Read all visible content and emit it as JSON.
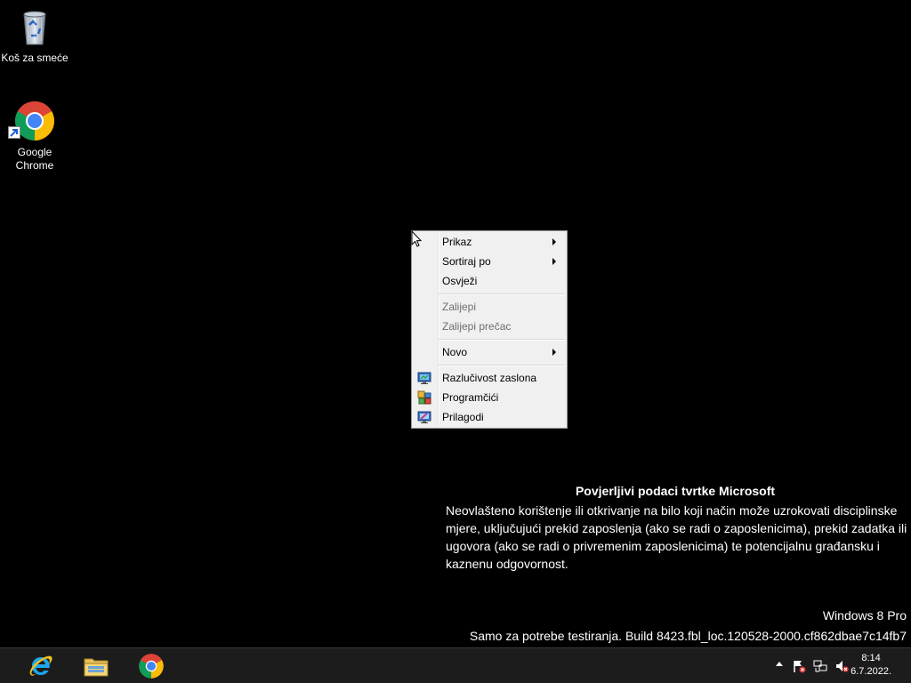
{
  "desktop": {
    "icons": [
      {
        "label": "Koš za smeće",
        "icon": "recycle-bin-icon"
      },
      {
        "label": "Google Chrome",
        "label_line1": "Google",
        "label_line2": "Chrome",
        "icon": "chrome-icon"
      }
    ]
  },
  "context_menu": {
    "items": [
      {
        "label": "Prikaz",
        "submenu": true,
        "enabled": true
      },
      {
        "label": "Sortiraj po",
        "submenu": true,
        "enabled": true
      },
      {
        "label": "Osvježi",
        "submenu": false,
        "enabled": true
      },
      {
        "label": "Zalijepi",
        "submenu": false,
        "enabled": false
      },
      {
        "label": "Zalijepi prečac",
        "submenu": false,
        "enabled": false
      },
      {
        "label": "Novo",
        "submenu": true,
        "enabled": true
      },
      {
        "label": "Razlučivost zaslona",
        "submenu": false,
        "enabled": true,
        "icon": "display-resolution-icon"
      },
      {
        "label": "Programčići",
        "submenu": false,
        "enabled": true,
        "icon": "gadgets-icon"
      },
      {
        "label": "Prilagodi",
        "submenu": false,
        "enabled": true,
        "icon": "personalize-icon"
      }
    ]
  },
  "watermark": {
    "title": "Povjerljivi podaci tvrtke Microsoft",
    "body": "Neovlašteno korištenje ili otkrivanje na bilo koji način može uzrokovati disciplinske mjere, uključujući prekid zaposlenja (ako se radi o zaposlenicima), prekid zadatka ili ugovora (ako se radi o privremenim zaposlenicima) te potencijalnu građansku i kaznenu odgovornost.",
    "edition": "Windows 8 Pro",
    "build": "Samo za potrebe testiranja. Build 8423.fbl_loc.120528-2000.cf862dbae7c14fb7"
  },
  "taskbar": {
    "pinned": [
      {
        "name": "Internet Explorer",
        "icon": "internet-explorer-icon"
      },
      {
        "name": "File Explorer",
        "icon": "file-explorer-icon"
      },
      {
        "name": "Google Chrome",
        "icon": "chrome-icon"
      }
    ],
    "tray_icons": [
      "show-hidden-icons-icon",
      "action-center-flag-icon",
      "network-icon",
      "volume-muted-icon"
    ],
    "clock": {
      "time": "8:14",
      "date": "6.7.2022."
    }
  },
  "colors": {
    "desktop_background": "#000000",
    "taskbar": "#1c1c1c",
    "menu_background": "#f0f0f0",
    "menu_disabled_text": "#6d6d6d"
  }
}
